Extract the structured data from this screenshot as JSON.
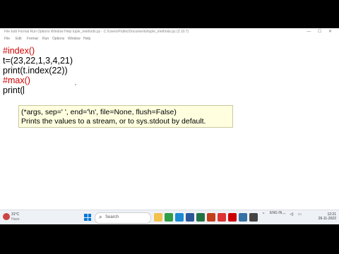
{
  "window": {
    "title": "File Edit Format Run Options Window Help tuple_methods.py - C:/Users/Public/Documents/tuple_methods.py (3.10.7)",
    "menu": [
      "File",
      "Edit",
      "Format",
      "Run",
      "Options",
      "Window",
      "Help"
    ]
  },
  "editor": {
    "lines": [
      {
        "text": "#index()",
        "kind": "comment"
      },
      {
        "text": "t=(23,22,1,3,4,21)",
        "kind": "code"
      },
      {
        "text": "print(t.index(22))",
        "kind": "code"
      },
      {
        "text": "#max()",
        "kind": "comment"
      },
      {
        "text": "print(",
        "kind": "code"
      }
    ]
  },
  "calltip": {
    "signature": "(*args, sep=' ', end='\\n', file=None, flush=False)",
    "description": "Prints the values to a stream, or to sys.stdout by default."
  },
  "taskbar": {
    "weather_temp": "31°C",
    "weather_desc": "Haze",
    "search_label": "Search",
    "apps": [
      {
        "name": "file-explorer-icon",
        "color": "#f2c14e"
      },
      {
        "name": "chrome-icon",
        "color": "#2f9e44"
      },
      {
        "name": "edge-icon",
        "color": "#1b8ad3"
      },
      {
        "name": "word-icon",
        "color": "#2b579a"
      },
      {
        "name": "excel-icon",
        "color": "#217346"
      },
      {
        "name": "powerpoint-icon",
        "color": "#c43e1c"
      },
      {
        "name": "app-l-icon",
        "color": "#d33"
      },
      {
        "name": "mcafee-icon",
        "color": "#c00"
      },
      {
        "name": "python-icon",
        "color": "#3572a5"
      },
      {
        "name": "app-extra-icon",
        "color": "#444"
      }
    ],
    "tray_lang": "ENG IN",
    "time": "12:21",
    "date": "26-11-2022"
  }
}
